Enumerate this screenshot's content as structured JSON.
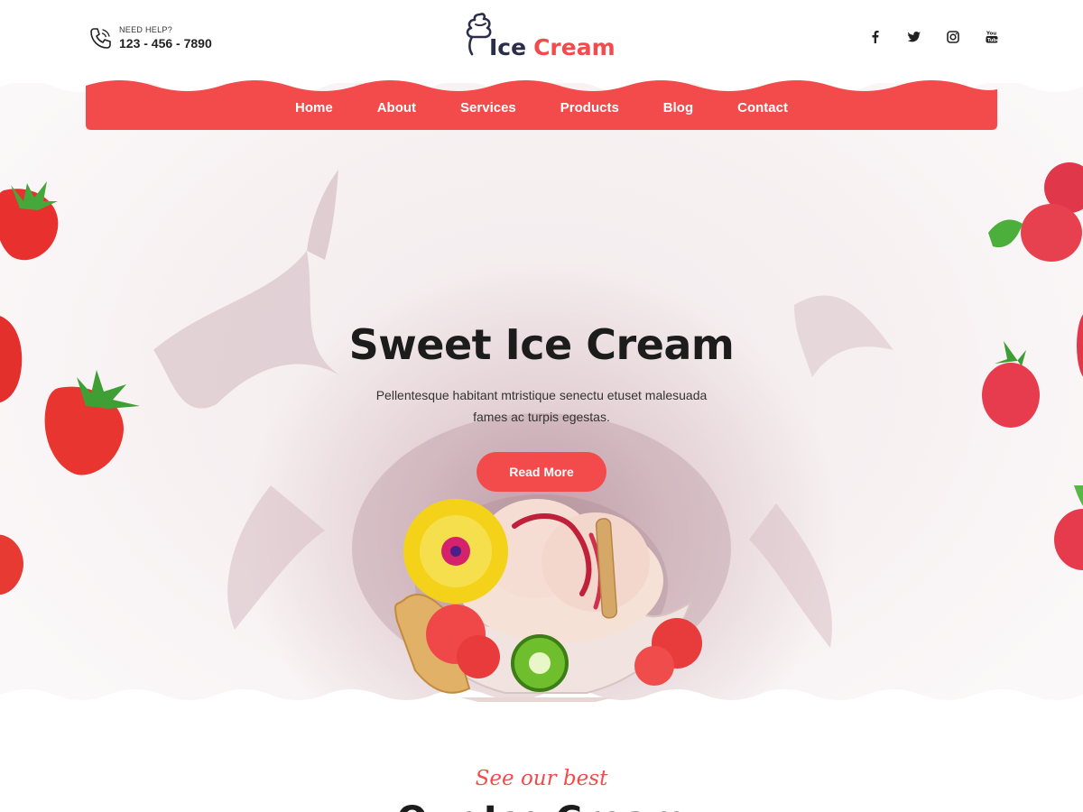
{
  "header": {
    "help_label": "NEED HELP?",
    "phone": "123 - 456 - 7890",
    "logo_word1": "Ice",
    "logo_word2": "Cream",
    "social_icons": [
      "facebook-icon",
      "twitter-icon",
      "instagram-icon",
      "youtube-icon"
    ]
  },
  "nav": {
    "items": [
      {
        "label": "Home"
      },
      {
        "label": "About"
      },
      {
        "label": "Services"
      },
      {
        "label": "Products"
      },
      {
        "label": "Blog"
      },
      {
        "label": "Contact"
      }
    ]
  },
  "hero": {
    "title": "Sweet Ice Cream",
    "text": "Pellentesque habitant mtristique senectu etuset malesuada fames ac turpis egestas.",
    "button_label": "Read More"
  },
  "section": {
    "kicker": "See our best",
    "title": "Our Ice Cream"
  },
  "colors": {
    "accent": "#f34b4b",
    "dark": "#2b2e4a",
    "text": "#1c1c1c"
  }
}
